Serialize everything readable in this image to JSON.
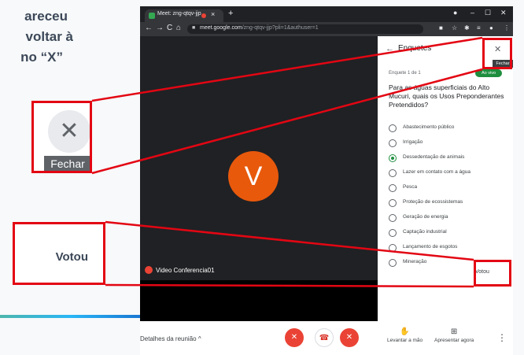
{
  "slide": {
    "line1": "areceu",
    "line2": "voltar à",
    "line3": "no “X”",
    "zoom_close_label": "Fechar",
    "zoom_votou_label": "Votou"
  },
  "browser": {
    "tab_title": "Meet: zng-qtqv-jjp",
    "url_host": "meet.google.com",
    "url_path": "/zng-qtqv-jjp?pli=1&authuser=1"
  },
  "meet": {
    "avatar_letter": "V",
    "participant_name": "Video Conferencia01",
    "meeting_details": "Detalhes da reunião",
    "raise_hand": "Levantar a mão",
    "present_now": "Apresentar agora"
  },
  "polls": {
    "title": "Enquetes",
    "close_tooltip": "Fechar",
    "counter": "Enquete 1 de 1",
    "status_badge": "Ao vivo",
    "question": "Para as águas superficiais do Alto Mucuri, quais os Usos Preponderantes Pretendidos?",
    "options": [
      "Abastecimento público",
      "Irrigação",
      "Dessedentação de animais",
      "Lazer em contato com a água",
      "Pesca",
      "Proteção de ecossistemas",
      "Geração de energia",
      "Captação industrial",
      "Lançamento de esgotos",
      "Mineração"
    ],
    "selected_index": 2,
    "voted_label": "Votou"
  },
  "colors": {
    "annotation_red": "#e30613",
    "avatar_orange": "#e8590c",
    "live_green": "#1e8e3e"
  }
}
